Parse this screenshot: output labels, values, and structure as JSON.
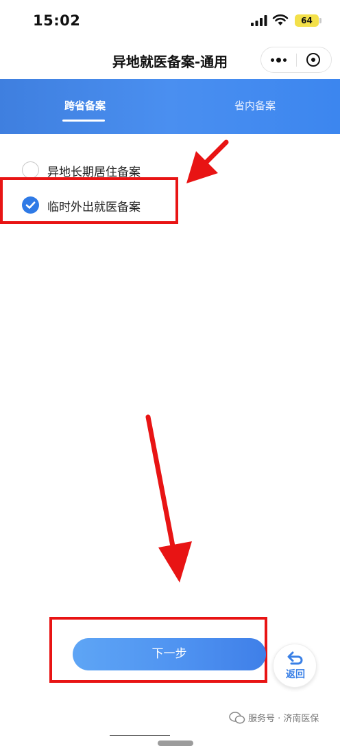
{
  "status_bar": {
    "time": "15:02",
    "battery": "64"
  },
  "title_bar": {
    "title": "异地就医备案-通用"
  },
  "tabs": [
    {
      "label": "跨省备案",
      "active": true
    },
    {
      "label": "省内备案",
      "active": false
    }
  ],
  "options": [
    {
      "label": "异地长期居住备案",
      "selected": false
    },
    {
      "label": "临时外出就医备案",
      "selected": true
    }
  ],
  "next_button": {
    "label": "下一步"
  },
  "back_button": {
    "label": "返回"
  },
  "watermark": {
    "text": "服务号 · 济南医保"
  },
  "colors": {
    "accent": "#2f7ae6",
    "header_blue": "#4a8ff0",
    "annotation_red": "#e81414"
  }
}
